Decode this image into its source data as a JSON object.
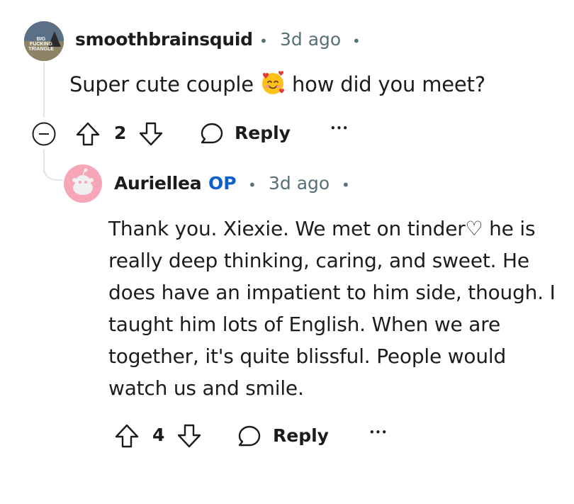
{
  "comment": {
    "author": "smoothbrainsquid",
    "avatar_text": [
      "BIG",
      "FUCKING",
      "TRIANGLE"
    ],
    "time": "3d ago",
    "separator": "•",
    "text_before_emoji": "Super cute couple",
    "emoji": "smiling-face-with-hearts",
    "text_after_emoji": "how did you meet?",
    "upvotes": "2",
    "reply_label": "Reply",
    "more_label": "•••"
  },
  "reply": {
    "author": "Auriellea",
    "op_badge": "OP",
    "time": "3d ago",
    "separator": "•",
    "text": "Thank you. Xiexie. We met on tinder♡ he is really deep thinking, caring, and sweet. He does have an impatient to him side, though. I taught him lots of English. When we are together, it's quite blissful. People would watch us and smile.",
    "upvotes": "4",
    "reply_label": "Reply",
    "more_label": "•••"
  },
  "colors": {
    "text": "#1c1c1c",
    "meta": "#576f76",
    "op": "#0a5fd1",
    "thread_line": "#e3e5e7",
    "snoo_avatar_bg": "#f6a6b6"
  }
}
